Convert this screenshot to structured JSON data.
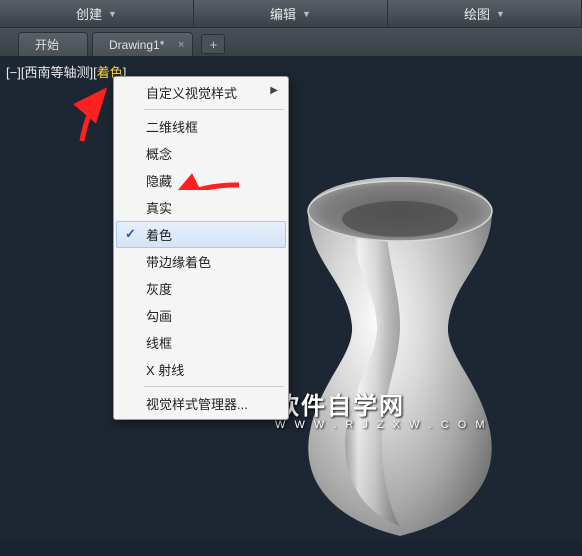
{
  "menu": {
    "create": "创建",
    "edit": "编辑",
    "draw": "绘图"
  },
  "tabs": {
    "start": "开始",
    "drawing": "Drawing1*"
  },
  "viewport_label": {
    "prefix": "[−][",
    "view": "西南等轴测",
    "mid": "][",
    "style": "着色",
    "suffix": "]"
  },
  "context_menu": {
    "custom_visual_styles": "自定义视觉样式",
    "sep1": true,
    "wireframe2d": "二维线框",
    "conceptual": "概念",
    "hidden": "隐藏",
    "realistic": "真实",
    "shaded": "着色",
    "shaded_edges": "带边缘着色",
    "grayscale": "灰度",
    "sketchy": "勾画",
    "wireframe": "线框",
    "xray": "X 射线",
    "sep2": true,
    "manager": "视觉样式管理器..."
  },
  "watermark": {
    "main": "软件自学网",
    "sub": "W W W . R J Z X W . C O M"
  }
}
